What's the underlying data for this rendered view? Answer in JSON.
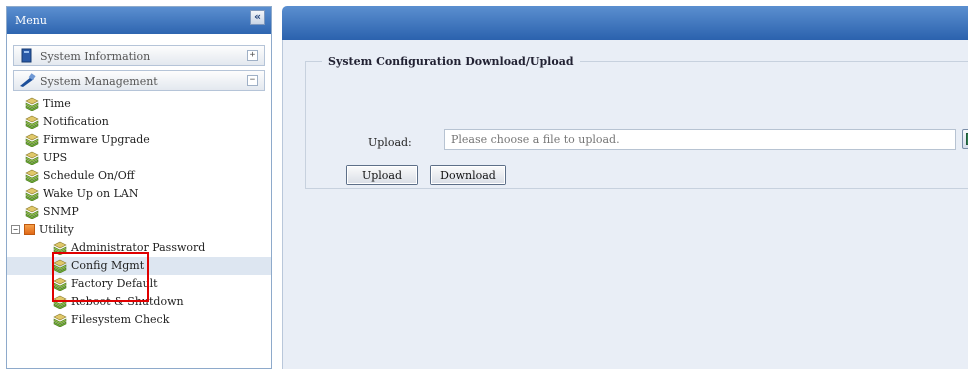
{
  "menu": {
    "title": "Menu",
    "collapse_glyph": "«",
    "sections": [
      {
        "label": "System Information",
        "toggle": "+"
      },
      {
        "label": "System Management",
        "toggle": "−"
      }
    ],
    "items": [
      {
        "label": "Time"
      },
      {
        "label": "Notification"
      },
      {
        "label": "Firmware Upgrade"
      },
      {
        "label": "UPS"
      },
      {
        "label": "Schedule On/Off"
      },
      {
        "label": "Wake Up on LAN"
      },
      {
        "label": "SNMP"
      }
    ],
    "utility": {
      "label": "Utility",
      "toggle": "−",
      "items": [
        {
          "label": "Administrator Password"
        },
        {
          "label": "Config Mgmt"
        },
        {
          "label": "Factory Default"
        },
        {
          "label": "Reboot & Shutdown"
        },
        {
          "label": "Filesystem Check"
        }
      ]
    },
    "selected": "Config Mgmt"
  },
  "content": {
    "section_title": "System Configuration Download/Upload",
    "upload_label": "Upload:",
    "upload_placeholder": "Please choose a file to upload.",
    "upload_button": "Upload",
    "download_button": "Download"
  },
  "colors": {
    "header_blue": "#2e65b0",
    "content_bg": "#e9eef6",
    "highlight_red": "#e00000"
  },
  "icons": {
    "tree_leaf": "layers-icon",
    "browse": "browse-file-icon"
  }
}
